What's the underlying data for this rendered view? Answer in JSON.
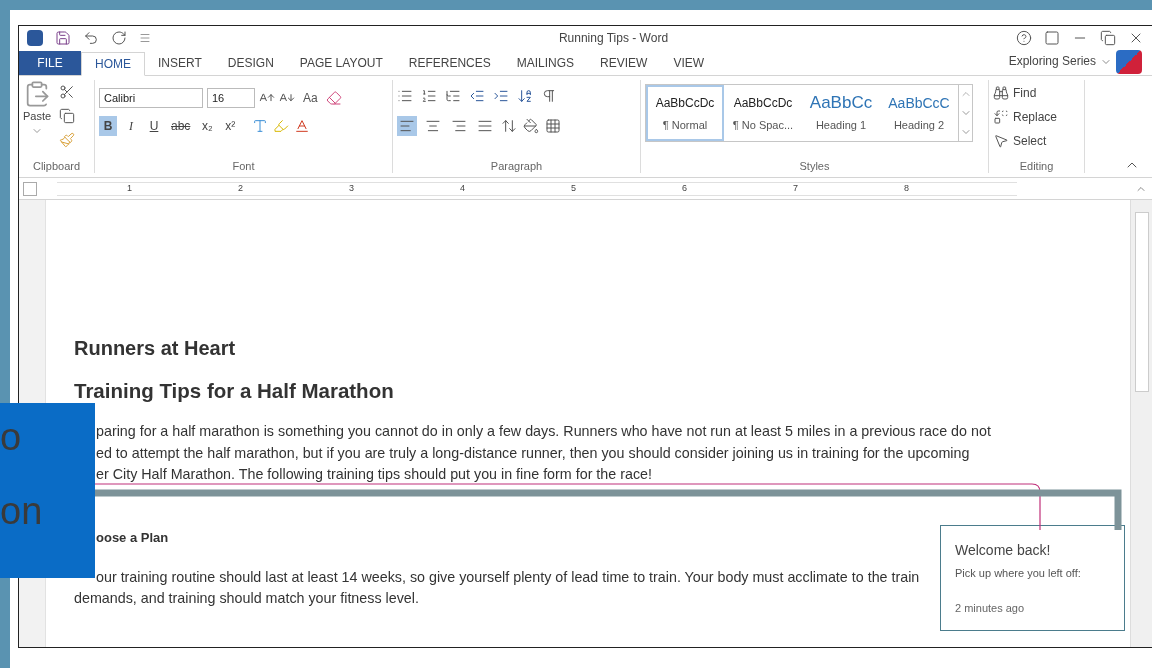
{
  "window": {
    "title": "Running Tips - Word",
    "account": "Exploring Series"
  },
  "tabs": [
    {
      "label": "FILE",
      "kind": "file",
      "selected": false
    },
    {
      "label": "HOME",
      "kind": "tab",
      "selected": true
    },
    {
      "label": "INSERT",
      "kind": "tab",
      "selected": false
    },
    {
      "label": "DESIGN",
      "kind": "tab",
      "selected": false
    },
    {
      "label": "PAGE LAYOUT",
      "kind": "tab",
      "selected": false
    },
    {
      "label": "REFERENCES",
      "kind": "tab",
      "selected": false
    },
    {
      "label": "MAILINGS",
      "kind": "tab",
      "selected": false
    },
    {
      "label": "REVIEW",
      "kind": "tab",
      "selected": false
    },
    {
      "label": "VIEW",
      "kind": "tab",
      "selected": false
    }
  ],
  "ribbon": {
    "paste": "Paste",
    "font_name": "Calibri",
    "font_size": "16",
    "change_case": "Aa",
    "format_buttons": [
      {
        "label": "B",
        "kind": "bold",
        "selected": true
      },
      {
        "label": "I",
        "kind": "italic",
        "selected": false
      },
      {
        "label": "U",
        "kind": "underline",
        "selected": false
      },
      {
        "label": "abc",
        "kind": "strike",
        "selected": false
      },
      {
        "label": "x₂",
        "kind": "sub",
        "selected": false
      },
      {
        "label": "x²",
        "kind": "sup",
        "selected": false
      }
    ],
    "alignments": [
      {
        "kind": "left",
        "selected": true
      },
      {
        "kind": "center",
        "selected": false
      },
      {
        "kind": "right",
        "selected": false
      },
      {
        "kind": "justify",
        "selected": false
      }
    ],
    "styles": [
      {
        "preview": "AaBbCcDc",
        "label": "¶ Normal",
        "kind": "normal",
        "selected": true
      },
      {
        "preview": "AaBbCcDc",
        "label": "¶ No Spac...",
        "kind": "normal",
        "selected": false
      },
      {
        "preview": "AaBbCc",
        "label": "Heading 1",
        "kind": "heading1",
        "selected": false
      },
      {
        "preview": "AaBbCcC",
        "label": "Heading 2",
        "kind": "heading2",
        "selected": false
      }
    ],
    "editing": [
      {
        "label": "Find",
        "kind": "find"
      },
      {
        "label": "Replace",
        "kind": "replace"
      },
      {
        "label": "Select",
        "kind": "select"
      }
    ],
    "groups": [
      "Clipboard",
      "Font",
      "Paragraph",
      "Styles",
      "Editing"
    ]
  },
  "ruler": [
    "1",
    "2",
    "3",
    "4",
    "5",
    "6",
    "7",
    "8"
  ],
  "document": {
    "title": "Runners at Heart",
    "heading": "Training Tips for a Half Marathon",
    "paragraph": [
      "paring for a half marathon is something you cannot do in only a few days. Runners who have not run at least 5 miles in a previous race do not",
      "ed to attempt the half marathon, but if you are truly a long-distance runner, then you should consider joining us in training for the upcoming",
      "er City Half Marathon. The following training tips should put you in fine form for the race!"
    ],
    "subheading": "oose a Plan",
    "body": [
      "our training routine should last at least 14 weeks, so give yourself plenty of lead time to train. Your body must acclimate to the train",
      "demands, and training should match your fitness level."
    ]
  },
  "popup": {
    "title": "Welcome back!",
    "text": "Pick up where you left off:",
    "time": "2 minutes ago"
  },
  "callout": [
    "o",
    "on"
  ]
}
